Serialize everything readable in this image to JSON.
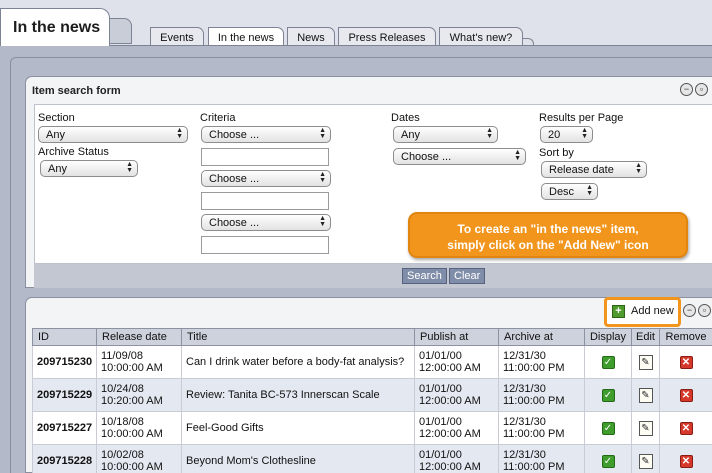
{
  "header": {
    "title": "In the news",
    "tabs": [
      {
        "label": "Events"
      },
      {
        "label": "In the news"
      },
      {
        "label": "News"
      },
      {
        "label": "Press Releases"
      },
      {
        "label": "What's new?"
      }
    ]
  },
  "search_form": {
    "title": "Item search form",
    "section": {
      "label": "Section",
      "value": "Any"
    },
    "archive_status": {
      "label": "Archive Status",
      "value": "Any"
    },
    "criteria": {
      "label": "Criteria",
      "selects": [
        "Choose ...",
        "Choose ...",
        "Choose ..."
      ]
    },
    "dates": {
      "label": "Dates",
      "value": "Any",
      "range_value": "Choose ..."
    },
    "results_per_page": {
      "label": "Results per Page",
      "value": "20"
    },
    "sort_by": {
      "label": "Sort by",
      "field": "Release date",
      "order": "Desc"
    },
    "search_button": "Search",
    "clear_button": "Clear"
  },
  "callout": {
    "line1": "To create an \"in the news\" item,",
    "line2": "simply click on the \"Add New\" icon",
    "color": "#f2951c"
  },
  "results": {
    "add_new_label": "Add new",
    "columns": [
      "ID",
      "Release date",
      "Title",
      "Publish at",
      "Archive at",
      "Display",
      "Edit",
      "Remove"
    ],
    "rows": [
      {
        "id": "209715230",
        "release_date": "11/09/08",
        "release_time": "10:00:00 AM",
        "title": "Can I drink water before a body-fat analysis?",
        "publish_date": "01/01/00",
        "publish_time": "12:00:00 AM",
        "archive_date": "12/31/30",
        "archive_time": "11:00:00 PM"
      },
      {
        "id": "209715229",
        "release_date": "10/24/08",
        "release_time": "10:20:00 AM",
        "title": "Review: Tanita BC-573 Innerscan Scale",
        "publish_date": "01/01/00",
        "publish_time": "12:00:00 AM",
        "archive_date": "12/31/30",
        "archive_time": "11:00:00 PM"
      },
      {
        "id": "209715227",
        "release_date": "10/18/08",
        "release_time": "10:00:00 AM",
        "title": "Feel-Good Gifts",
        "publish_date": "01/01/00",
        "publish_time": "12:00:00 AM",
        "archive_date": "12/31/30",
        "archive_time": "11:00:00 PM"
      },
      {
        "id": "209715228",
        "release_date": "10/02/08",
        "release_time": "10:00:00 AM",
        "title": "Beyond Mom's Clothesline",
        "publish_date": "01/01/00",
        "publish_time": "12:00:00 AM",
        "archive_date": "12/31/30",
        "archive_time": "11:00:00 PM"
      }
    ]
  },
  "icons": {
    "collapse": "minus-circle-icon",
    "restore": "window-circle-icon",
    "display": "check-icon",
    "edit": "edit-icon",
    "remove": "x-icon",
    "add": "plus-icon"
  }
}
